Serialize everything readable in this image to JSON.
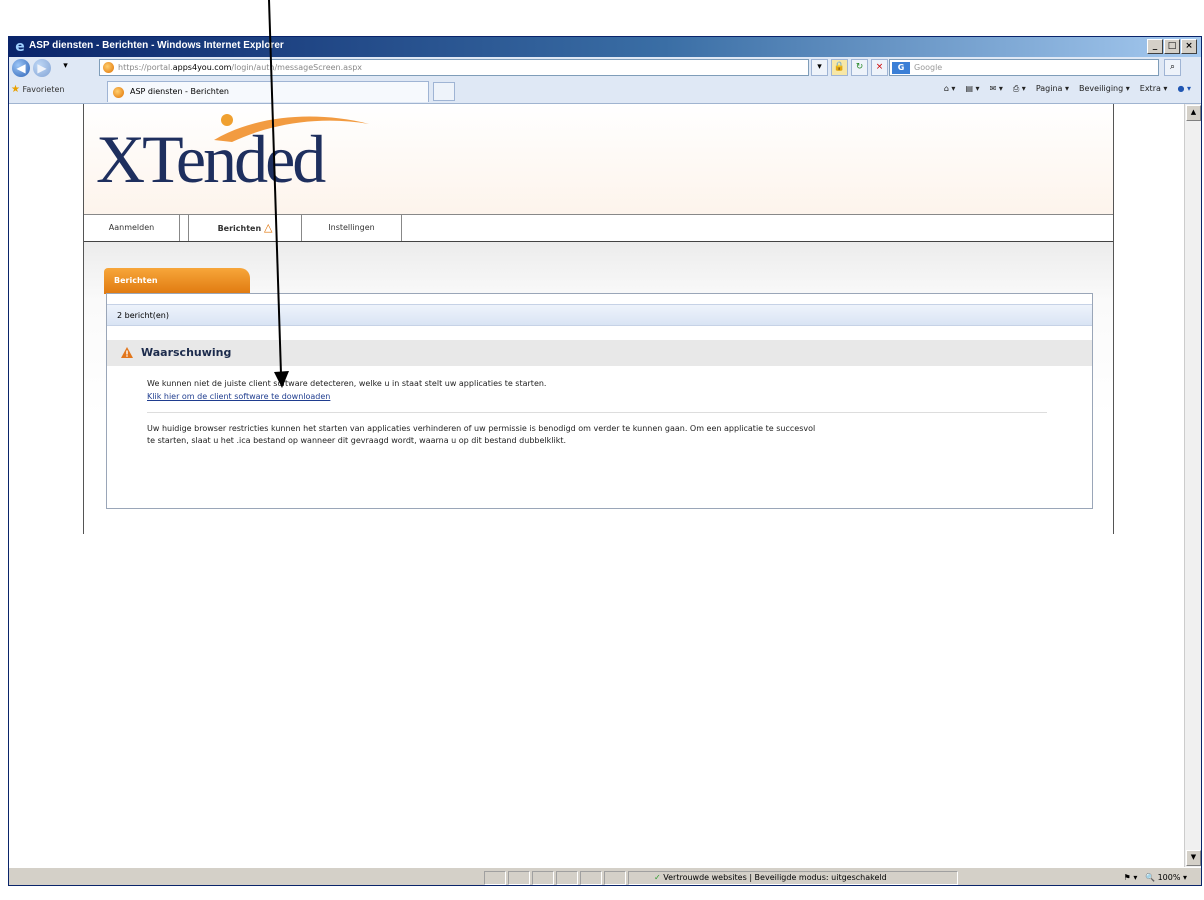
{
  "window": {
    "title": "ASP diensten - Berichten - Windows Internet Explorer"
  },
  "address_bar": {
    "url_prefix": "https://portal.",
    "url_host": "apps4you.com",
    "url_path": "/login/auth/messageScreen.aspx",
    "search_placeholder": "Google"
  },
  "favorites_bar": {
    "favorites_label": "Favorieten",
    "tab_title": "ASP diensten - Berichten"
  },
  "command_bar": {
    "page": "Pagina",
    "security": "Beveiliging",
    "extra": "Extra"
  },
  "site": {
    "logo_text": "XTended",
    "nav": {
      "login": "Aanmelden",
      "messages": "Berichten",
      "settings": "Instellingen"
    },
    "panel_tab": "Berichten",
    "message_count": "2 bericht(en)",
    "warning_title": "Waarschuwing",
    "msg1": "We kunnen niet de juiste client software detecteren, welke u in staat stelt uw applicaties te starten.",
    "download_link": "Klik hier om de client software te downloaden",
    "msg2_line1": "Uw huidige browser restricties kunnen het starten van applicaties verhinderen of uw permissie is benodigd om verder te kunnen gaan. Om een applicatie te succesvol",
    "msg2_line2": "te starten, slaat u het .ica bestand op wanneer dit gevraagd wordt, waarna u op dit bestand dubbelklikt."
  },
  "status_bar": {
    "zone": "Vertrouwde websites | Beveiligde modus: uitgeschakeld",
    "zoom": "100%"
  },
  "colors": {
    "accent_orange": "#e07a10",
    "logo_navy": "#1e2f5e",
    "link_blue": "#1f3d8f"
  }
}
